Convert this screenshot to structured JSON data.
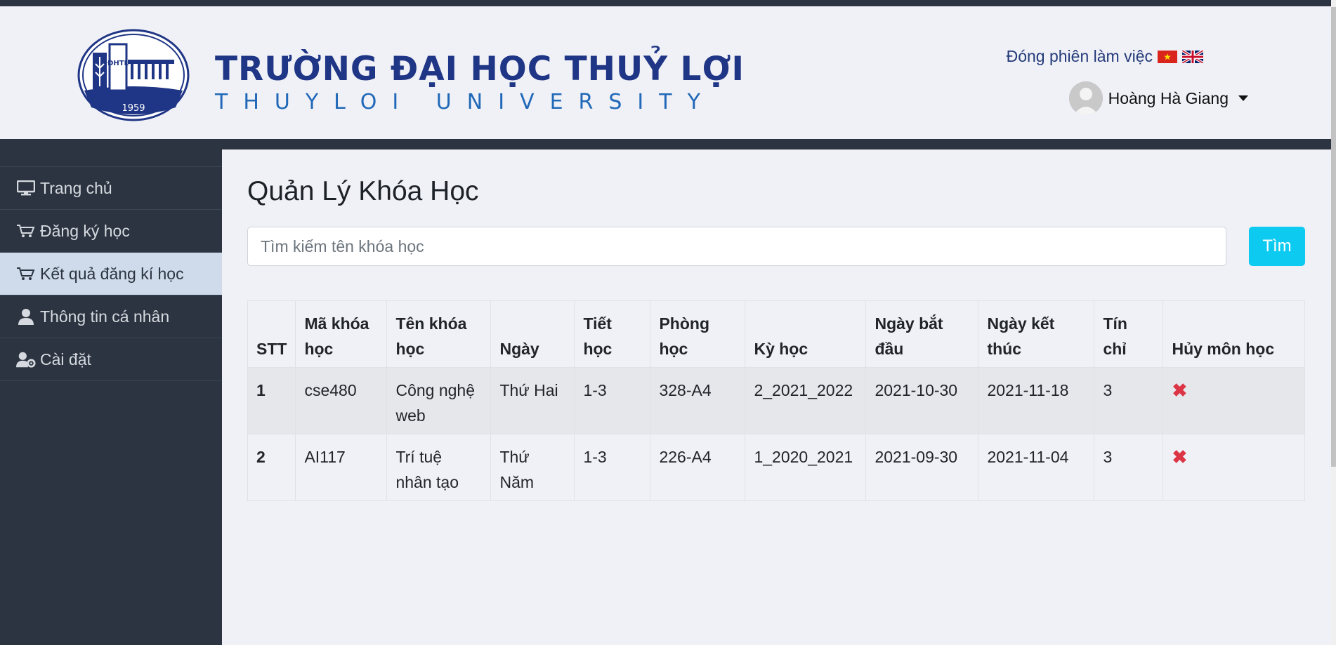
{
  "header": {
    "title_vn": "TRƯỜNG ĐẠI HỌC THUỶ LỢI",
    "title_en": "THUYLOI UNIVERSITY",
    "logo_text": "ĐHTL",
    "logo_year": "1959",
    "logout_label": "Đóng phiên làm việc",
    "user_name": "Hoàng Hà Giang"
  },
  "sidebar": {
    "items": [
      {
        "label": "Trang chủ",
        "icon": "monitor-icon"
      },
      {
        "label": "Đăng ký học",
        "icon": "cart-icon"
      },
      {
        "label": "Kết quả đăng kí học",
        "icon": "cart-icon",
        "active": true
      },
      {
        "label": "Thông tin cá nhân",
        "icon": "user-icon"
      },
      {
        "label": "Cài đặt",
        "icon": "user-gear-icon"
      }
    ]
  },
  "main": {
    "title": "Quản Lý Khóa Học",
    "search": {
      "placeholder": "Tìm kiếm tên khóa học",
      "value": "",
      "button_label": "Tìm"
    },
    "table": {
      "headers": [
        "STT",
        "Mã khóa học",
        "Tên khóa học",
        "Ngày",
        "Tiết học",
        "Phòng học",
        "Kỳ học",
        "Ngày bắt đầu",
        "Ngày kết thúc",
        "Tín chỉ",
        "Hủy môn học"
      ],
      "rows": [
        [
          "1",
          "cse480",
          "Công nghệ web",
          "Thứ Hai",
          "1-3",
          "328-A4",
          "2_2021_2022",
          "2021-10-30",
          "2021-11-18",
          "3"
        ],
        [
          "2",
          "AI117",
          "Trí tuệ nhân tạo",
          "Thứ Năm",
          "1-3",
          "226-A4",
          "1_2020_2021",
          "2021-09-30",
          "2021-11-04",
          "3"
        ]
      ]
    },
    "delete_icon": "✖"
  },
  "colors": {
    "sidebar_bg": "#2b3440",
    "sidebar_active_bg": "#cfdbea",
    "page_bg": "#f0f1f7",
    "brand_navy": "#1f3585",
    "brand_blue": "#2169b8",
    "search_button": "#0dcaf0",
    "delete_red": "#dc3545"
  }
}
